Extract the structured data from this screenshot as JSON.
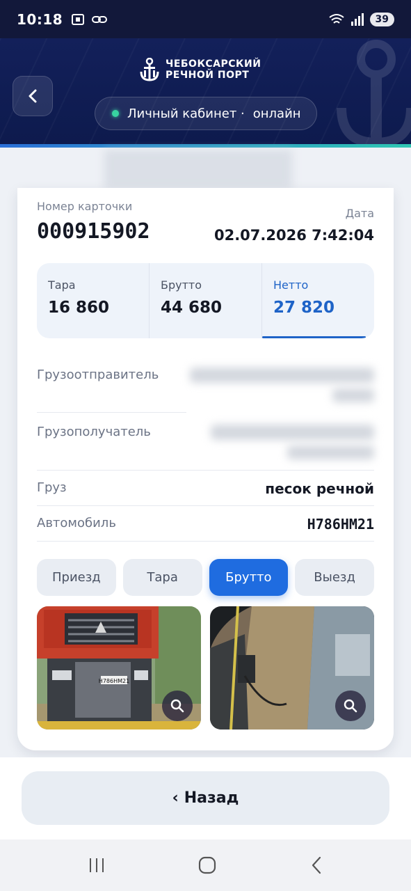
{
  "status_bar": {
    "time": "10:18",
    "battery": "39"
  },
  "header": {
    "logo_line1": "ЧЕБОКСАРСКИЙ",
    "logo_line2": "РЕЧНОЙ ПОРТ",
    "pill_text": "Личный кабинет ·",
    "pill_status": "онлайн"
  },
  "card": {
    "number_label": "Номер карточки",
    "number": "000915902",
    "date_label": "Дата",
    "date": "02.07.2026 7:42:04",
    "weights": [
      {
        "label": "Тара",
        "value": "16 860"
      },
      {
        "label": "Брутто",
        "value": "44 680"
      },
      {
        "label": "Нетто",
        "value": "27 820"
      }
    ],
    "shipper_label": "Грузоотправитель",
    "consignee_label": "Грузополучатель",
    "cargo_label": "Груз",
    "cargo_value": "песок речной",
    "vehicle_label": "Автомобиль",
    "vehicle_value": "Н786НМ21",
    "tabs": [
      "Приезд",
      "Тара",
      "Брутто",
      "Выезд"
    ],
    "active_tab": "Брутто",
    "truck_plate": "Н786НМ21"
  },
  "footer": {
    "back_label": "Назад",
    "back_arrow": "‹"
  },
  "colors": {
    "accent": "#1f6ce0",
    "header_bg": "#12183a",
    "online": "#38d3a1"
  }
}
